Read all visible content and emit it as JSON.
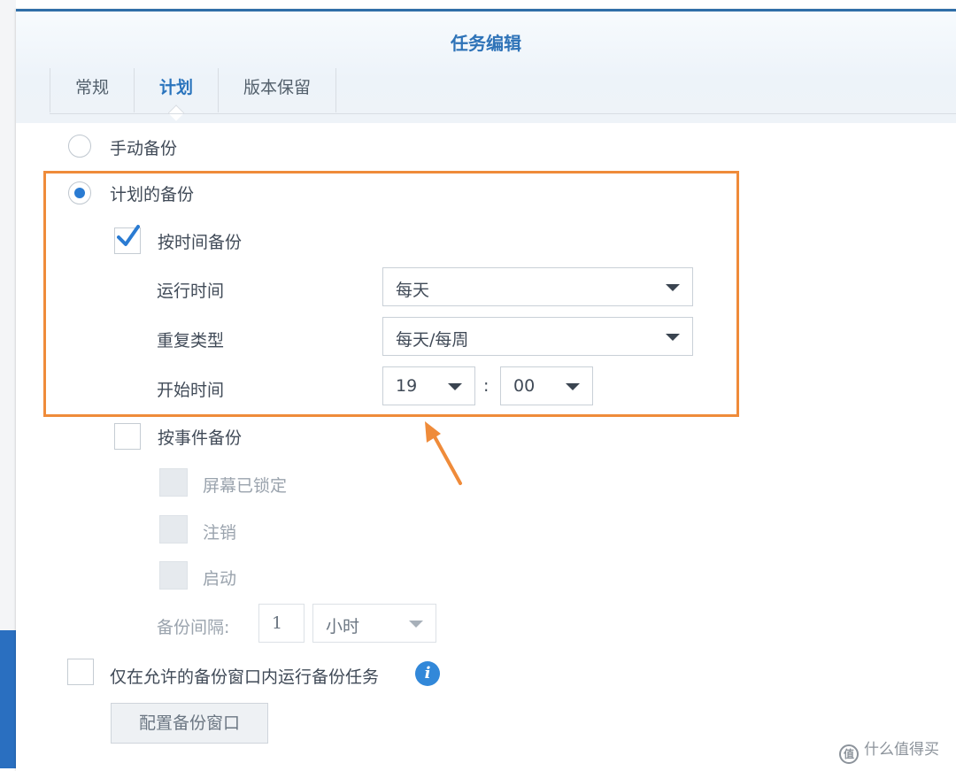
{
  "window": {
    "title": "任务编辑"
  },
  "tabs": [
    {
      "label": "常规",
      "active": false
    },
    {
      "label": "计划",
      "active": true
    },
    {
      "label": "版本保留",
      "active": false
    }
  ],
  "backup_mode": {
    "manual_label": "手动备份",
    "scheduled_label": "计划的备份",
    "selected": "scheduled"
  },
  "by_time": {
    "label": "按时间备份",
    "checked": true,
    "run_time_label": "运行时间",
    "run_time_value": "每天",
    "repeat_label": "重复类型",
    "repeat_value": "每天/每周",
    "start_label": "开始时间",
    "start_hour": "19",
    "separator": ":",
    "start_minute": "00"
  },
  "by_event": {
    "label": "按事件备份",
    "checked": false,
    "options": [
      "屏幕已锁定",
      "注销",
      "启动"
    ],
    "interval_label": "备份间隔:",
    "interval_value": "1",
    "interval_unit": "小时"
  },
  "window_option": {
    "label": "仅在允许的备份窗口内运行备份任务",
    "info_icon": "i",
    "button": "配置备份窗口"
  },
  "watermark": {
    "icon": "值",
    "text": "什么值得买"
  },
  "colors": {
    "accent": "#2e73b8",
    "highlight": "#ef8b3a"
  }
}
